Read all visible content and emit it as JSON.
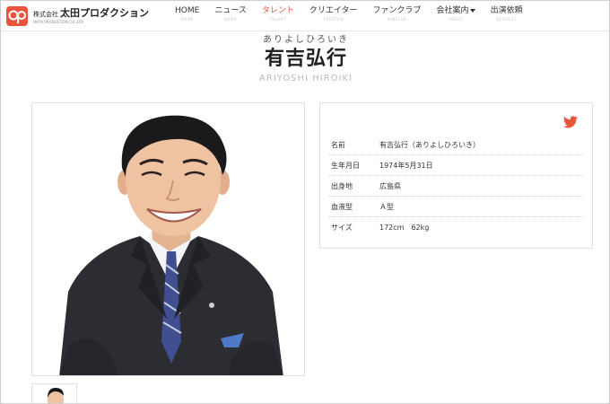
{
  "brand": {
    "name": "太田プロダクション",
    "corp_prefix": "株式会社",
    "tagline": "OHTA PRODUCTION CO.,LTD",
    "accent_color": "#e8543c"
  },
  "nav": {
    "items": [
      {
        "label": "HOME",
        "sub": "HOME"
      },
      {
        "label": "ニュース",
        "sub": "NEWS"
      },
      {
        "label": "タレント",
        "sub": "TALENT"
      },
      {
        "label": "クリエイター",
        "sub": "CREATOR"
      },
      {
        "label": "ファンクラブ",
        "sub": "FANCLUB"
      },
      {
        "label": "会社案内",
        "sub": "ABOUT"
      },
      {
        "label": "出演依頼",
        "sub": "REQUEST"
      }
    ],
    "active_index": 2
  },
  "talent": {
    "kana": "ありよしひろいき",
    "name": "有吉弘行",
    "roman": "ARIYOSHI HIROIKI"
  },
  "profile": {
    "share_icon": "twitter-icon",
    "rows": [
      {
        "key": "名前",
        "value": "有吉弘行（ありよしひろいき）"
      },
      {
        "key": "生年月日",
        "value": "1974年5月31日"
      },
      {
        "key": "出身地",
        "value": "広島県"
      },
      {
        "key": "血液型",
        "value": "Ａ型"
      },
      {
        "key": "サイズ",
        "value": "172cm　62kg"
      }
    ]
  }
}
